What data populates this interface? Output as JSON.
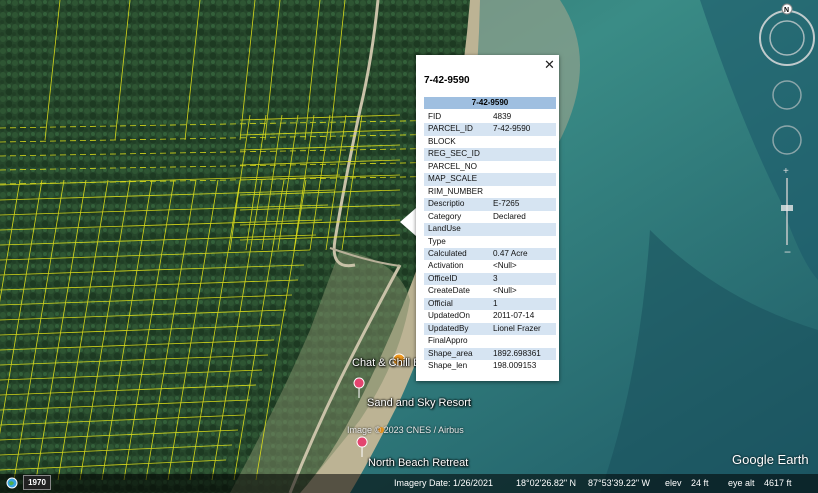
{
  "popup": {
    "title": "7-42-9590",
    "close_icon": "close-icon",
    "table_header": "7-42-9590",
    "rows": [
      {
        "key": "FID",
        "value": "4839"
      },
      {
        "key": "PARCEL_ID",
        "value": "7-42-9590"
      },
      {
        "key": "BLOCK",
        "value": ""
      },
      {
        "key": "REG_SEC_ID",
        "value": ""
      },
      {
        "key": "PARCEL_NO",
        "value": ""
      },
      {
        "key": "MAP_SCALE",
        "value": ""
      },
      {
        "key": "RIM_NUMBER",
        "value": ""
      },
      {
        "key": "Descriptio",
        "value": "E-7265"
      },
      {
        "key": "Category",
        "value": "Declared"
      },
      {
        "key": "LandUse",
        "value": ""
      },
      {
        "key": "Type",
        "value": ""
      },
      {
        "key": "Calculated",
        "value": "0.47 Acre"
      },
      {
        "key": "Activation",
        "value": "<Null>"
      },
      {
        "key": "OfficeID",
        "value": "3"
      },
      {
        "key": "CreateDate",
        "value": "<Null>"
      },
      {
        "key": "Official",
        "value": "1"
      },
      {
        "key": "UpdatedOn",
        "value": "2011-07-14"
      },
      {
        "key": "UpdatedBy",
        "value": "Lionel Frazer"
      },
      {
        "key": "FinalAppro",
        "value": ""
      },
      {
        "key": "Shape_area",
        "value": "1892.698361"
      },
      {
        "key": "Shape_len",
        "value": "198.009153"
      }
    ]
  },
  "places": {
    "chat_chill": "Chat & Chill B",
    "sand_sky": "Sand and Sky Resort",
    "north_beach": "North Beach Retreat"
  },
  "attribution": "Image © 2023 CNES / Airbus",
  "brand": "Google Earth",
  "compass_label": "N",
  "status": {
    "year": "1970",
    "imagery_date": "Imagery Date: 1/26/2021",
    "lat": "18°02'26.82\" N",
    "lon": "87°53'39.22\" W",
    "elev_label": "elev",
    "elev": "24 ft",
    "eye_alt_label": "eye alt",
    "eye_alt": "4617 ft"
  },
  "colors": {
    "parcel_lines": "#e6e619",
    "forest": "#24462a",
    "sea": "#2f7d78",
    "beach": "#b9b08f",
    "table_header": "#9fbfe0",
    "table_stripe": "#d6e4f2"
  }
}
